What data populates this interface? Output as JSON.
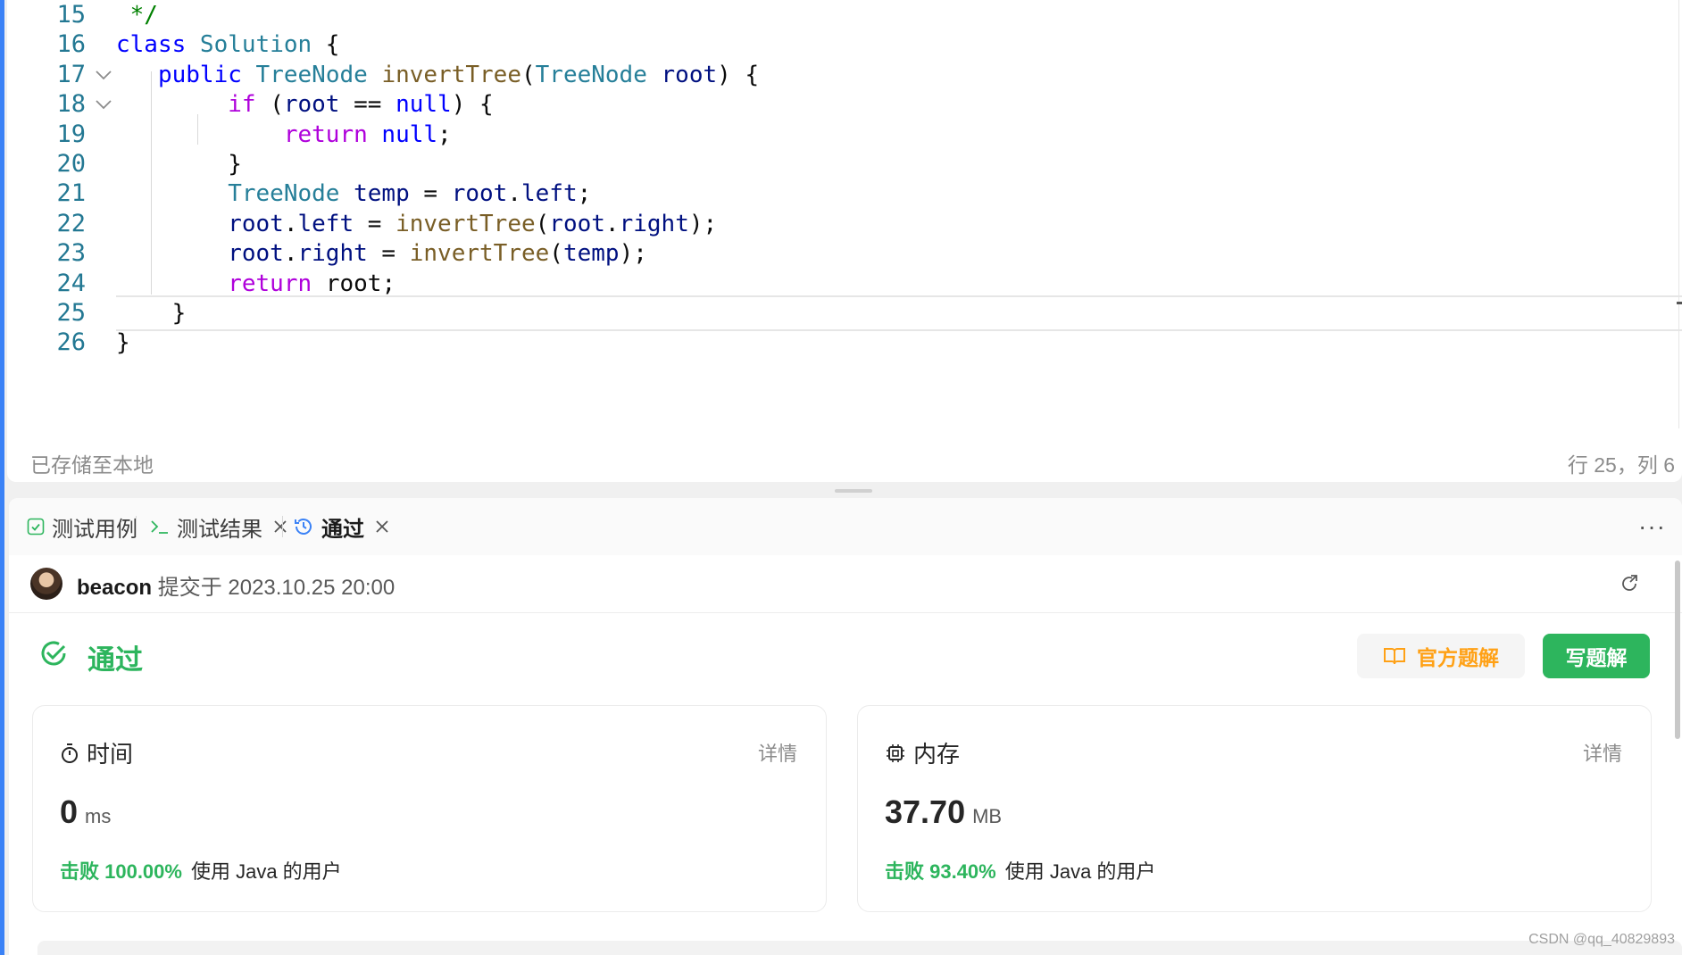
{
  "editor": {
    "lines": [
      {
        "no": "15",
        "fold": false,
        "current": false,
        "tokens": [
          {
            "t": " */",
            "c": "comment"
          }
        ]
      },
      {
        "no": "16",
        "fold": false,
        "current": false,
        "tokens": [
          {
            "t": "class ",
            "c": "kw"
          },
          {
            "t": "Solution",
            "c": "type"
          },
          {
            "t": " {",
            "c": "default"
          }
        ]
      },
      {
        "no": "17",
        "fold": true,
        "current": false,
        "tokens": [
          {
            "t": "   public ",
            "c": "kw"
          },
          {
            "t": "TreeNode",
            "c": "type"
          },
          {
            "t": " ",
            "c": "default"
          },
          {
            "t": "invertTree",
            "c": "fn"
          },
          {
            "t": "(",
            "c": "default"
          },
          {
            "t": "TreeNode",
            "c": "type"
          },
          {
            "t": " ",
            "c": "default"
          },
          {
            "t": "root",
            "c": "var"
          },
          {
            "t": ") {",
            "c": "default"
          }
        ]
      },
      {
        "no": "18",
        "fold": true,
        "current": false,
        "tokens": [
          {
            "t": "        if ",
            "c": "ctrl"
          },
          {
            "t": "(",
            "c": "default"
          },
          {
            "t": "root",
            "c": "var"
          },
          {
            "t": " == ",
            "c": "default"
          },
          {
            "t": "null",
            "c": "kw"
          },
          {
            "t": ") {",
            "c": "default"
          }
        ]
      },
      {
        "no": "19",
        "fold": false,
        "current": false,
        "tokens": [
          {
            "t": "            return ",
            "c": "ctrl"
          },
          {
            "t": "null",
            "c": "kw"
          },
          {
            "t": ";",
            "c": "default"
          }
        ]
      },
      {
        "no": "20",
        "fold": false,
        "current": false,
        "tokens": [
          {
            "t": "        }",
            "c": "default"
          }
        ]
      },
      {
        "no": "21",
        "fold": false,
        "current": false,
        "tokens": [
          {
            "t": "        TreeNode",
            "c": "type"
          },
          {
            "t": " ",
            "c": "default"
          },
          {
            "t": "temp",
            "c": "var"
          },
          {
            "t": " = ",
            "c": "default"
          },
          {
            "t": "root",
            "c": "var"
          },
          {
            "t": ".",
            "c": "default"
          },
          {
            "t": "left",
            "c": "var"
          },
          {
            "t": ";",
            "c": "default"
          }
        ]
      },
      {
        "no": "22",
        "fold": false,
        "current": false,
        "tokens": [
          {
            "t": "        root",
            "c": "var"
          },
          {
            "t": ".",
            "c": "default"
          },
          {
            "t": "left",
            "c": "var"
          },
          {
            "t": " = ",
            "c": "default"
          },
          {
            "t": "invertTree",
            "c": "fn"
          },
          {
            "t": "(",
            "c": "default"
          },
          {
            "t": "root",
            "c": "var"
          },
          {
            "t": ".",
            "c": "default"
          },
          {
            "t": "right",
            "c": "var"
          },
          {
            "t": ");",
            "c": "default"
          }
        ]
      },
      {
        "no": "23",
        "fold": false,
        "current": false,
        "tokens": [
          {
            "t": "        root",
            "c": "var"
          },
          {
            "t": ".",
            "c": "default"
          },
          {
            "t": "right",
            "c": "var"
          },
          {
            "t": " = ",
            "c": "default"
          },
          {
            "t": "invertTree",
            "c": "fn"
          },
          {
            "t": "(",
            "c": "default"
          },
          {
            "t": "temp",
            "c": "var"
          },
          {
            "t": ");",
            "c": "default"
          }
        ]
      },
      {
        "no": "24",
        "fold": false,
        "current": false,
        "tokens": [
          {
            "t": "        return ",
            "c": "ctrl"
          },
          {
            "t": "root",
            "c": "default"
          },
          {
            "t": ";",
            "c": "default"
          }
        ]
      },
      {
        "no": "25",
        "fold": false,
        "current": true,
        "tokens": [
          {
            "t": "    }",
            "c": "default"
          }
        ]
      },
      {
        "no": "26",
        "fold": false,
        "current": false,
        "tokens": [
          {
            "t": "}",
            "c": "default"
          }
        ]
      }
    ],
    "status_saved": "已存储至本地",
    "cursor_position": "行 25，列 6"
  },
  "tabs": [
    {
      "label": "测试用例",
      "icon": "checkbox-icon",
      "closable": false,
      "active": false
    },
    {
      "label": "测试结果",
      "icon": "terminal-icon",
      "closable": true,
      "active": false
    },
    {
      "label": "通过",
      "icon": "history-clock-icon",
      "closable": true,
      "active": true
    }
  ],
  "submission": {
    "user": "beacon",
    "submitted_at": "提交于 2023.10.25 20:00",
    "status": "通过",
    "official_solution_label": "官方题解",
    "write_solution_label": "写题解"
  },
  "stats": {
    "time": {
      "title": "时间",
      "detail": "详情",
      "value": "0",
      "unit": "ms",
      "beat_pct": "击败 100.00%",
      "beat_text": "使用 Java 的用户"
    },
    "memory": {
      "title": "内存",
      "detail": "详情",
      "value": "37.70",
      "unit": "MB",
      "beat_pct": "击败 93.40%",
      "beat_text": "使用 Java 的用户"
    }
  },
  "colors": {
    "accent_green": "#2db55d",
    "accent_orange": "#ffa116",
    "accent_blue": "#3b82f6"
  },
  "watermark": "CSDN @qq_40829893"
}
